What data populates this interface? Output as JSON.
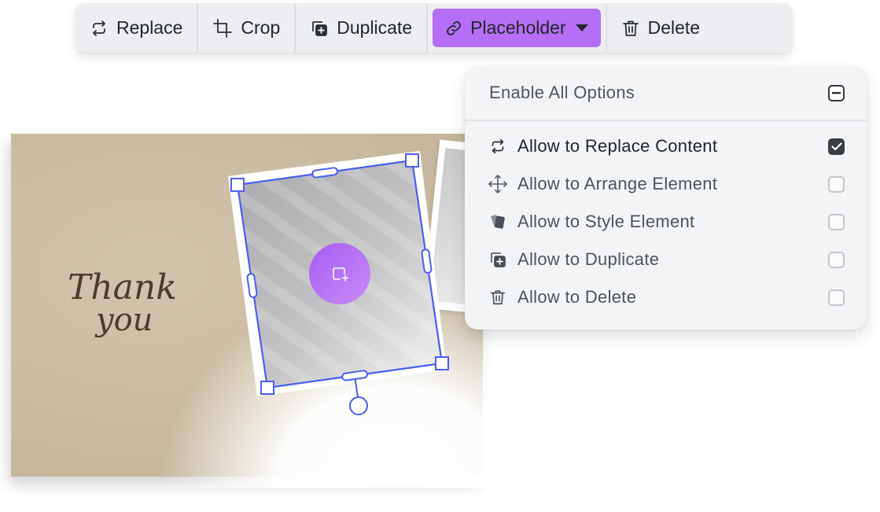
{
  "toolbar": {
    "replace_label": "Replace",
    "crop_label": "Crop",
    "duplicate_label": "Duplicate",
    "placeholder_label": "Placeholder",
    "delete_label": "Delete",
    "active_color": "#b56ef5"
  },
  "canvas": {
    "card_text_line1": "Thank",
    "card_text_line2": "you",
    "selection_color": "#4b5ef0",
    "placeholder_button_icon": "add-image-icon"
  },
  "panel": {
    "header_label": "Enable All Options",
    "header_state": "mixed",
    "options": [
      {
        "label": "Allow to Replace Content",
        "icon": "replace-icon",
        "checked": true
      },
      {
        "label": "Allow to Arrange Element",
        "icon": "move-icon",
        "checked": false
      },
      {
        "label": "Allow to Style Element",
        "icon": "style-icon",
        "checked": false
      },
      {
        "label": "Allow to Duplicate",
        "icon": "duplicate-icon",
        "checked": false
      },
      {
        "label": "Allow to Delete",
        "icon": "trash-icon",
        "checked": false
      }
    ]
  }
}
